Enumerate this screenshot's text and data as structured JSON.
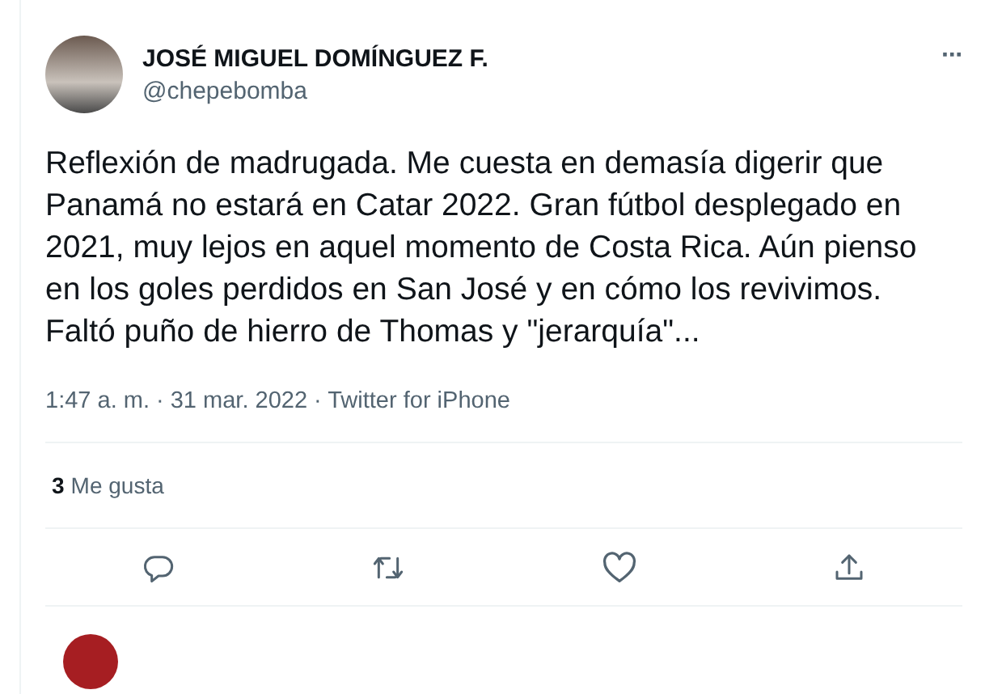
{
  "author": {
    "name": "JOSÉ MIGUEL DOMÍNGUEZ F.",
    "handle": "@chepebomba"
  },
  "more": "···",
  "text": "Reflexión de madrugada. Me cuesta en demasía digerir que Panamá no estará en Catar 2022. Gran fútbol desplegado en 2021, muy lejos en aquel momento de Costa Rica. Aún pienso en los goles perdidos en San José y en cómo los revivimos. Faltó puño de hierro de Thomas y \"jerarquía\"...",
  "meta": "1:47 a. m. · 31 mar. 2022 · Twitter for iPhone",
  "likes": {
    "count": "3",
    "label": "Me gusta"
  }
}
